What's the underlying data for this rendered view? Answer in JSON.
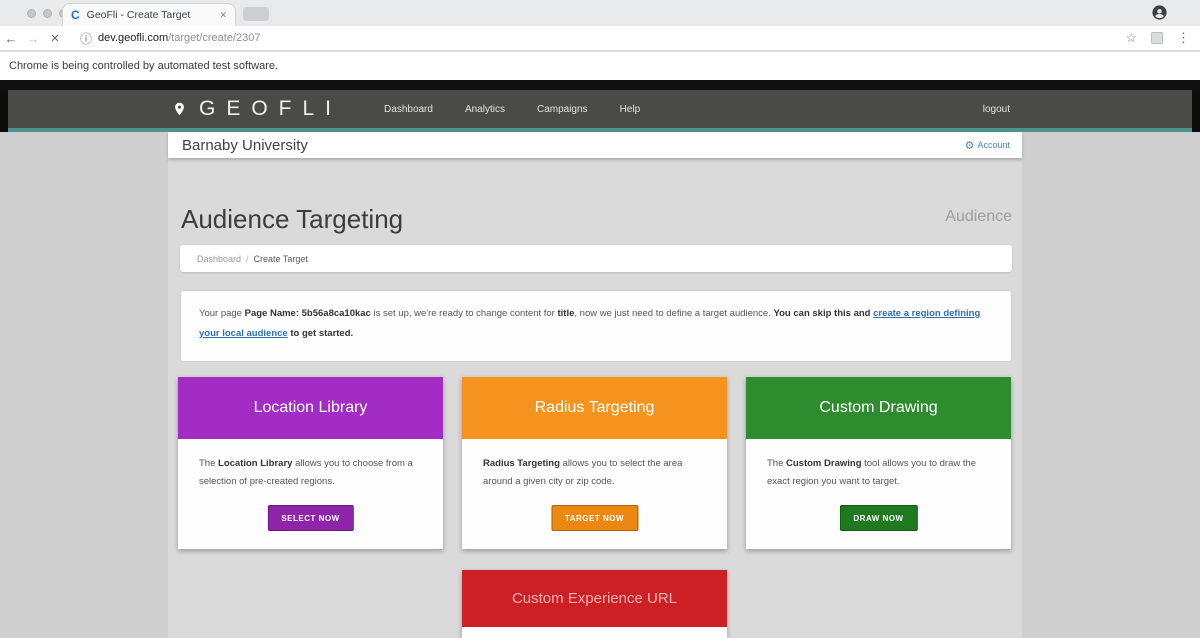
{
  "browser": {
    "tab_title": "GeoFli - Create Target",
    "tab_close": "✕",
    "favicon_letter": "C",
    "back": "←",
    "forward": "→",
    "stop": "✕",
    "url_info": "ⓘ",
    "url_host": "dev.geofli.com",
    "url_path": "/target/create/2307",
    "bookmark_star": "☆",
    "menu_dots": "⋮",
    "automation_banner": "Chrome is being controlled by automated test software."
  },
  "nav": {
    "brand": "GEOFLI",
    "items": [
      "Dashboard",
      "Analytics",
      "Campaigns",
      "Help"
    ],
    "logout_label": "logout",
    "accent_color": "#4f918d",
    "bar_color": "#4a4a47"
  },
  "header": {
    "university": "Barnaby University",
    "account_label": "Account",
    "gear_glyph": "⚙",
    "link_color": "#4a86c5"
  },
  "page": {
    "title": "Audience Targeting",
    "watermark": "Audience",
    "breadcrumb": [
      "Dashboard",
      "Create Target"
    ],
    "breadcrumb_separator": "/",
    "intro_segments": [
      {
        "text": "Your page "
      },
      {
        "text": "Page Name: 5b56a8ca10kac",
        "bold": true
      },
      {
        "text": " is set up, we're ready to change content for "
      },
      {
        "text": "title",
        "bold": true
      },
      {
        "text": ", now we just need to define a target audience. "
      },
      {
        "text": "You can skip this and ",
        "bold": true
      },
      {
        "text": "create a region defining your local audience",
        "link": true
      },
      {
        "text": " to get started.",
        "bold": true
      }
    ]
  },
  "cards": [
    {
      "title": "Location Library",
      "body_segments": [
        {
          "text": "The "
        },
        {
          "text": "Location Library",
          "bold": true
        },
        {
          "text": " allows you to choose from a selection of pre-created regions."
        }
      ],
      "button": "SELECT NOW",
      "colors": {
        "header": "#a32cc4",
        "button": "#8e24aa"
      }
    },
    {
      "title": "Radius Targeting",
      "body_segments": [
        {
          "text": "Radius Targeting",
          "bold": true
        },
        {
          "text": " allows you to select the area around a given city or zip code."
        }
      ],
      "button": "TARGET NOW",
      "colors": {
        "header": "#f6921e",
        "button": "#ec8710"
      }
    },
    {
      "title": "Custom Drawing",
      "body_segments": [
        {
          "text": "The "
        },
        {
          "text": "Custom Drawing",
          "bold": true
        },
        {
          "text": " tool allows you to draw the exact region you want to target."
        }
      ],
      "button": "DRAW NOW",
      "colors": {
        "header": "#2e8b2e",
        "button": "#1f7a1f"
      }
    }
  ],
  "bottom_card": {
    "title": "Custom Experience URL",
    "colors": {
      "header": "#cd2026"
    }
  }
}
